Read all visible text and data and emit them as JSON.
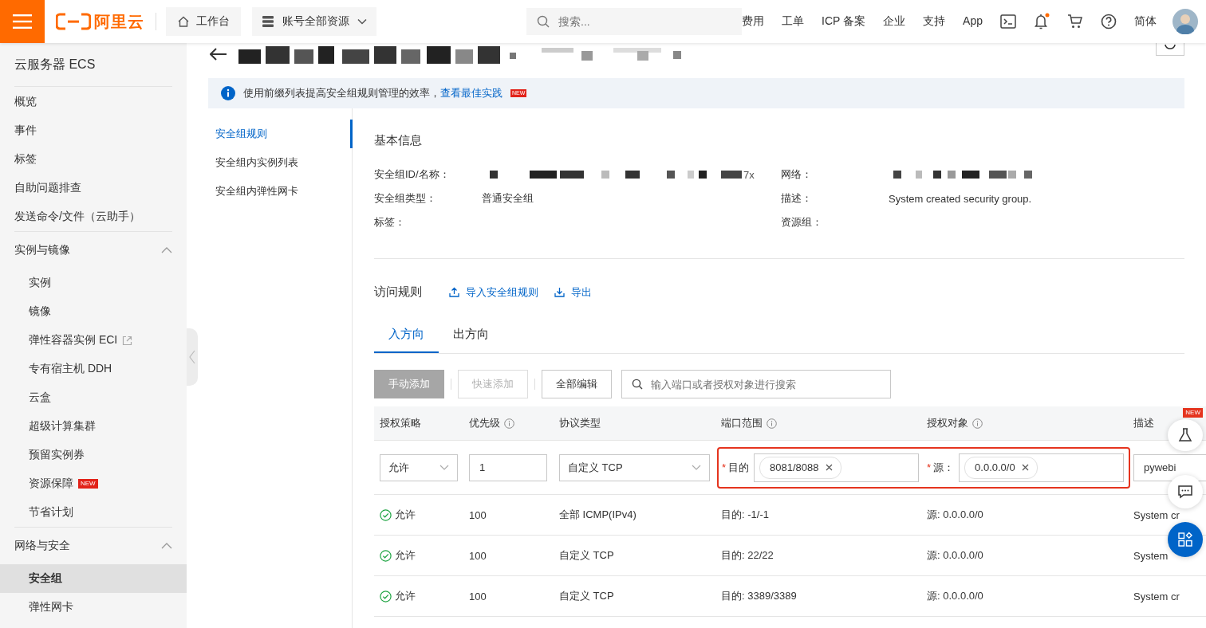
{
  "topbar": {
    "logo_text": "阿里云",
    "workbench": "工作台",
    "resources": "账号全部资源",
    "search_placeholder": "搜索...",
    "links": [
      "费用",
      "工单",
      "ICP 备案",
      "企业",
      "支持",
      "App"
    ],
    "language": "简体"
  },
  "sidebar": {
    "title": "云服务器 ECS",
    "items": [
      {
        "label": "概览",
        "selected": false
      },
      {
        "label": "事件",
        "selected": false
      },
      {
        "label": "标签",
        "selected": false
      },
      {
        "label": "自助问题排查",
        "selected": false
      },
      {
        "label": "发送命令/文件（云助手）",
        "selected": false
      }
    ],
    "groups": [
      {
        "label": "实例与镜像",
        "expanded": true,
        "children": [
          {
            "label": "实例",
            "kind": "link",
            "selected": false
          },
          {
            "label": "镜像",
            "kind": "link",
            "selected": false
          },
          {
            "label": "弹性容器实例 ECI",
            "kind": "external",
            "selected": false
          },
          {
            "label": "专有宿主机 DDH",
            "kind": "link",
            "selected": false
          },
          {
            "label": "云盒",
            "kind": "link",
            "selected": false
          },
          {
            "label": "超级计算集群",
            "kind": "link",
            "selected": false
          },
          {
            "label": "预留实例券",
            "kind": "link",
            "selected": false
          },
          {
            "label": "资源保障",
            "kind": "link",
            "badge": "NEW",
            "selected": false
          },
          {
            "label": "节省计划",
            "kind": "link",
            "selected": false
          }
        ]
      },
      {
        "label": "网络与安全",
        "expanded": true,
        "children": [
          {
            "label": "安全组",
            "kind": "link",
            "selected": true
          },
          {
            "label": "弹性网卡",
            "kind": "link",
            "selected": false
          }
        ]
      }
    ]
  },
  "notice": {
    "text": "使用前缀列表提高安全组规则管理的效率，",
    "link": "查看最佳实践",
    "badge": "NEW"
  },
  "subnav": [
    {
      "label": "安全组规则",
      "selected": true
    },
    {
      "label": "安全组内实例列表",
      "selected": false
    },
    {
      "label": "安全组内弹性网卡",
      "selected": false
    }
  ],
  "basic_info": {
    "title": "基本信息",
    "fields": [
      {
        "label": "安全组ID/名称：",
        "kind": "redacted",
        "value": "7x"
      },
      {
        "label": "网络：",
        "kind": "redacted"
      },
      {
        "label": "安全组类型：",
        "kind": "text",
        "value": "普通安全组"
      },
      {
        "label": "描述：",
        "kind": "text",
        "value": "System created security group."
      },
      {
        "label": "标签：",
        "kind": "text"
      },
      {
        "label": "资源组：",
        "kind": "text"
      }
    ]
  },
  "rules": {
    "title": "访问规则",
    "actions": [
      {
        "label": "导入安全组规则",
        "kind": "upload"
      },
      {
        "label": "导出",
        "kind": "download"
      }
    ],
    "tabs": [
      {
        "label": "入方向",
        "selected": true
      },
      {
        "label": "出方向",
        "selected": false
      }
    ],
    "buttons": [
      {
        "label": "手动添加",
        "kind": "primary",
        "disabled": true
      },
      {
        "label": "快速添加",
        "kind": "normal",
        "disabled": true
      },
      {
        "label": "全部编辑",
        "kind": "normal",
        "disabled": false
      }
    ],
    "search_placeholder": "输入端口或者授权对象进行搜索",
    "columns": [
      {
        "label": "授权策略",
        "info": false
      },
      {
        "label": "优先级",
        "info": true
      },
      {
        "label": "协议类型",
        "info": false
      },
      {
        "label": "端口范围",
        "info": true
      },
      {
        "label": "授权对象",
        "info": true
      },
      {
        "label": "描述",
        "info": false
      }
    ],
    "edit_row": {
      "policy": "允许",
      "priority": "1",
      "protocol": "自定义 TCP",
      "highlighted": true,
      "port_mark": "*",
      "port_label": "目的",
      "source_mark": "*",
      "port_tag": "8081/8088",
      "source_label": "源：",
      "source_tag": "0.0.0.0/0",
      "description": "pywebi"
    },
    "rows": [
      {
        "policy": "允许",
        "priority": "100",
        "protocol": "全部 ICMP(IPv4)",
        "port": "目的: -1/-1",
        "source": "源: 0.0.0.0/0",
        "description": "System cr"
      },
      {
        "policy": "允许",
        "priority": "100",
        "protocol": "自定义 TCP",
        "port": "目的: 22/22",
        "source": "源: 0.0.0.0/0",
        "description": "System"
      },
      {
        "policy": "允许",
        "priority": "100",
        "protocol": "自定义 TCP",
        "port": "目的: 3389/3389",
        "source": "源: 0.0.0.0/0",
        "description": "System cr"
      }
    ]
  },
  "floating": [
    {
      "kind": "lab",
      "badge": "NEW"
    },
    {
      "kind": "chat"
    },
    {
      "kind": "apps"
    }
  ]
}
